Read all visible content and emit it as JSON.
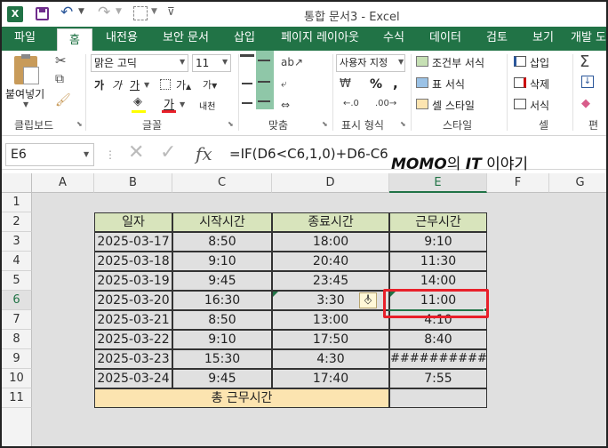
{
  "titlebar": {
    "title": "통합 문서3 - Excel",
    "app_icon": "excel-icon"
  },
  "tabs": [
    {
      "label": "파일"
    },
    {
      "label": "홈"
    },
    {
      "label": "내전용"
    },
    {
      "label": "보안 문서"
    },
    {
      "label": "삽입"
    },
    {
      "label": "페이지 레이아웃"
    },
    {
      "label": "수식"
    },
    {
      "label": "데이터"
    },
    {
      "label": "검토"
    },
    {
      "label": "보기"
    },
    {
      "label": "개발 도"
    }
  ],
  "ribbon": {
    "clipboard": {
      "label": "클립보드",
      "paste": "붙여넣기"
    },
    "font": {
      "label": "글꼴",
      "font_name": "맑은 고딕",
      "font_size": "11",
      "bold": "가",
      "italic": "가",
      "underline": "가",
      "color_letter": "가",
      "phonetic": "내천"
    },
    "alignment": {
      "label": "맞춤"
    },
    "number": {
      "label": "표시 형식",
      "format": "사용자 지정",
      "percent": "%",
      "comma": ","
    },
    "styles": {
      "label": "스타일",
      "conditional": "조건부 서식",
      "table": "표 서식",
      "cell": "셀 스타일"
    },
    "cells": {
      "label": "셀",
      "insert": "삽입",
      "delete": "삭제",
      "format": "서식"
    },
    "edit": {
      "label": "편"
    }
  },
  "formula_bar": {
    "name_box": "E6",
    "formula": "=IF(D6<C6,1,0)+D6-C6",
    "fx": "fx"
  },
  "watermark": {
    "brand": "MOMO",
    "mid": "의 ",
    "it": "IT",
    "tail": " 이야기"
  },
  "columns": [
    "A",
    "B",
    "C",
    "D",
    "E",
    "F",
    "G"
  ],
  "rows": [
    "1",
    "2",
    "3",
    "4",
    "5",
    "6",
    "7",
    "8",
    "9",
    "10",
    "11"
  ],
  "table": {
    "headers": [
      "일자",
      "시작시간",
      "종료시간",
      "근무시간"
    ],
    "data": [
      [
        "2025-03-17",
        "8:50",
        "18:00",
        "9:10"
      ],
      [
        "2025-03-18",
        "9:10",
        "20:40",
        "11:30"
      ],
      [
        "2025-03-19",
        "9:45",
        "23:45",
        "14:00"
      ],
      [
        "2025-03-20",
        "16:30",
        "3:30",
        "11:00"
      ],
      [
        "2025-03-21",
        "8:50",
        "13:00",
        "4:10"
      ],
      [
        "2025-03-22",
        "9:10",
        "17:50",
        "8:40"
      ],
      [
        "2025-03-23",
        "15:30",
        "4:30",
        "###########"
      ],
      [
        "2025-03-24",
        "9:45",
        "17:40",
        "7:55"
      ]
    ],
    "total_label": "총 근무시간",
    "total_value": ""
  },
  "colors": {
    "excel_green": "#217346",
    "header_fill": "#d8e4bc",
    "total_fill": "#fce4b0",
    "highlight": "#e8202a"
  }
}
